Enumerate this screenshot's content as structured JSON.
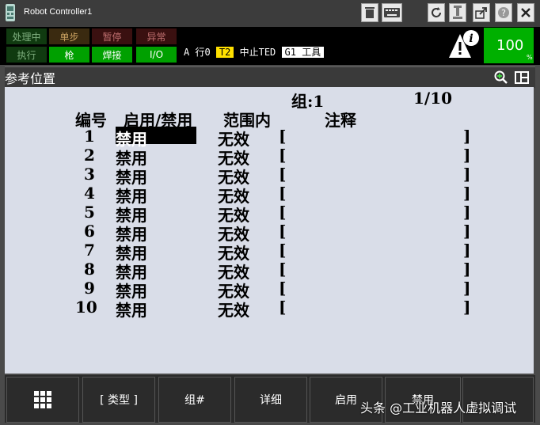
{
  "window": {
    "title": "Robot Controller1"
  },
  "status": {
    "indicators_top": [
      "处理中",
      "单步",
      "暂停",
      "异常"
    ],
    "indicators_bottom": [
      "执行",
      "枪",
      "焊接",
      "I/O"
    ],
    "line_prefix": "A  行0",
    "mode": "T2",
    "state": "中止TED",
    "tool": "G1 工具",
    "speed": "100",
    "speed_unit": "%"
  },
  "screen": {
    "title": "参考位置"
  },
  "table": {
    "group_label": "组:1",
    "page": "1/10",
    "headers": {
      "no": "编号",
      "enable": "启用/禁用",
      "range": "范围内",
      "comment": "注释"
    },
    "rows": [
      {
        "no": "1",
        "enable": "禁用",
        "range": "无效",
        "open": "[",
        "close": "]"
      },
      {
        "no": "2",
        "enable": "禁用",
        "range": "无效",
        "open": "[",
        "close": "]"
      },
      {
        "no": "3",
        "enable": "禁用",
        "range": "无效",
        "open": "[",
        "close": "]"
      },
      {
        "no": "4",
        "enable": "禁用",
        "range": "无效",
        "open": "[",
        "close": "]"
      },
      {
        "no": "5",
        "enable": "禁用",
        "range": "无效",
        "open": "[",
        "close": "]"
      },
      {
        "no": "6",
        "enable": "禁用",
        "range": "无效",
        "open": "[",
        "close": "]"
      },
      {
        "no": "7",
        "enable": "禁用",
        "range": "无效",
        "open": "[",
        "close": "]"
      },
      {
        "no": "8",
        "enable": "禁用",
        "range": "无效",
        "open": "[",
        "close": "]"
      },
      {
        "no": "9",
        "enable": "禁用",
        "range": "无效",
        "open": "[",
        "close": "]"
      },
      {
        "no": "10",
        "enable": "禁用",
        "range": "无效",
        "open": "[",
        "close": "]"
      }
    ]
  },
  "softkeys": [
    "[ 类型 ]",
    "组#",
    "详细",
    "启用",
    "禁用"
  ],
  "watermark": "头条 @工业机器人虚拟调试",
  "colors": {
    "content_bg": "#d9dde8",
    "status_green": "#00a000",
    "mode_yellow": "#ffe000"
  }
}
